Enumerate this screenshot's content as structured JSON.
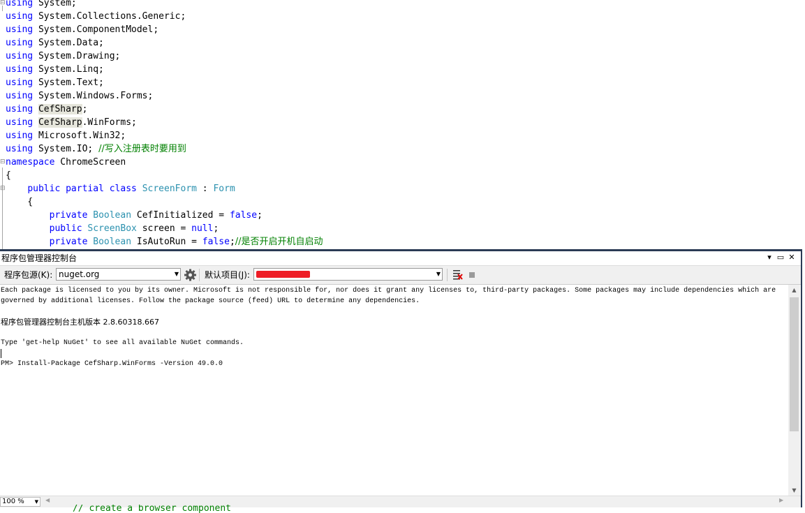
{
  "editor": {
    "lines": [
      [
        {
          "t": "using",
          "c": "kw"
        },
        {
          "t": " System;",
          "c": ""
        }
      ],
      [
        {
          "t": "using",
          "c": "kw"
        },
        {
          "t": " System.Collections.Generic;",
          "c": ""
        }
      ],
      [
        {
          "t": "using",
          "c": "kw"
        },
        {
          "t": " System.ComponentModel;",
          "c": ""
        }
      ],
      [
        {
          "t": "using",
          "c": "kw"
        },
        {
          "t": " System.Data;",
          "c": ""
        }
      ],
      [
        {
          "t": "using",
          "c": "kw"
        },
        {
          "t": " System.Drawing;",
          "c": ""
        }
      ],
      [
        {
          "t": "using",
          "c": "kw"
        },
        {
          "t": " System.Linq;",
          "c": ""
        }
      ],
      [
        {
          "t": "using",
          "c": "kw"
        },
        {
          "t": " System.Text;",
          "c": ""
        }
      ],
      [
        {
          "t": "using",
          "c": "kw"
        },
        {
          "t": " System.Windows.Forms;",
          "c": ""
        }
      ],
      [
        {
          "t": "using",
          "c": "kw"
        },
        {
          "t": " ",
          "c": ""
        },
        {
          "t": "CefSharp",
          "c": "hl"
        },
        {
          "t": ";",
          "c": ""
        }
      ],
      [
        {
          "t": "using",
          "c": "kw"
        },
        {
          "t": " ",
          "c": ""
        },
        {
          "t": "CefSharp",
          "c": "hl"
        },
        {
          "t": ".WinForms;",
          "c": ""
        }
      ],
      [
        {
          "t": "using",
          "c": "kw"
        },
        {
          "t": " Microsoft.Win32;",
          "c": ""
        }
      ],
      [
        {
          "t": "using",
          "c": "kw"
        },
        {
          "t": " System.IO; ",
          "c": ""
        },
        {
          "t": "//写入注册表时要用到",
          "c": "cm"
        }
      ],
      [
        {
          "t": "namespace",
          "c": "kw"
        },
        {
          "t": " ChromeScreen",
          "c": ""
        }
      ],
      [
        {
          "t": "{",
          "c": ""
        }
      ],
      [
        {
          "t": "    ",
          "c": ""
        },
        {
          "t": "public",
          "c": "kw"
        },
        {
          "t": " ",
          "c": ""
        },
        {
          "t": "partial",
          "c": "kw"
        },
        {
          "t": " ",
          "c": ""
        },
        {
          "t": "class",
          "c": "kw"
        },
        {
          "t": " ",
          "c": ""
        },
        {
          "t": "ScreenForm",
          "c": "ty"
        },
        {
          "t": " : ",
          "c": ""
        },
        {
          "t": "Form",
          "c": "ty"
        }
      ],
      [
        {
          "t": "    {",
          "c": ""
        }
      ],
      [
        {
          "t": "        ",
          "c": ""
        },
        {
          "t": "private",
          "c": "kw"
        },
        {
          "t": " ",
          "c": ""
        },
        {
          "t": "Boolean",
          "c": "ty"
        },
        {
          "t": " CefInitialized = ",
          "c": ""
        },
        {
          "t": "false",
          "c": "kw"
        },
        {
          "t": ";",
          "c": ""
        }
      ],
      [
        {
          "t": "        ",
          "c": ""
        },
        {
          "t": "public",
          "c": "kw"
        },
        {
          "t": " ",
          "c": ""
        },
        {
          "t": "ScreenBox",
          "c": "ty"
        },
        {
          "t": " screen = ",
          "c": ""
        },
        {
          "t": "null",
          "c": "kw"
        },
        {
          "t": ";",
          "c": ""
        }
      ],
      [
        {
          "t": "        ",
          "c": ""
        },
        {
          "t": "private",
          "c": "kw"
        },
        {
          "t": " ",
          "c": ""
        },
        {
          "t": "Boolean",
          "c": "ty"
        },
        {
          "t": " IsAutoRun = ",
          "c": ""
        },
        {
          "t": "false",
          "c": "kw"
        },
        {
          "t": ";",
          "c": ""
        },
        {
          "t": "//是否开启开机自启动",
          "c": "cm"
        }
      ]
    ],
    "trailing_line": "// create a browser component"
  },
  "console": {
    "title": "程序包管理器控制台",
    "title_buttons": {
      "dropdown": "▾",
      "maximize": "▭",
      "close": "✕"
    },
    "toolbar": {
      "source_label": "程序包源(K):",
      "source_value": "nuget.org",
      "default_project_label": "默认项目(J):",
      "default_project_value": "",
      "redaction_color": "#ee1c25"
    },
    "output_lines": [
      "Each package is licensed to you by its owner. Microsoft is not responsible for, nor does it grant any licenses to, third-party packages. Some packages may include dependencies which are",
      "governed by additional licenses. Follow the package source (feed) URL to determine any dependencies.",
      "",
      "程序包管理器控制台主机版本 2.8.60318.667",
      "",
      "Type 'get-help NuGet' to see all available NuGet commands.",
      "",
      "PM> Install-Package CefSharp.WinForms -Version 49.0.0"
    ],
    "zoom": "100 %"
  },
  "colors": {
    "keyword": "#0000ff",
    "type": "#2b91af",
    "comment": "#008000",
    "panel_border": "#2b3b55"
  }
}
